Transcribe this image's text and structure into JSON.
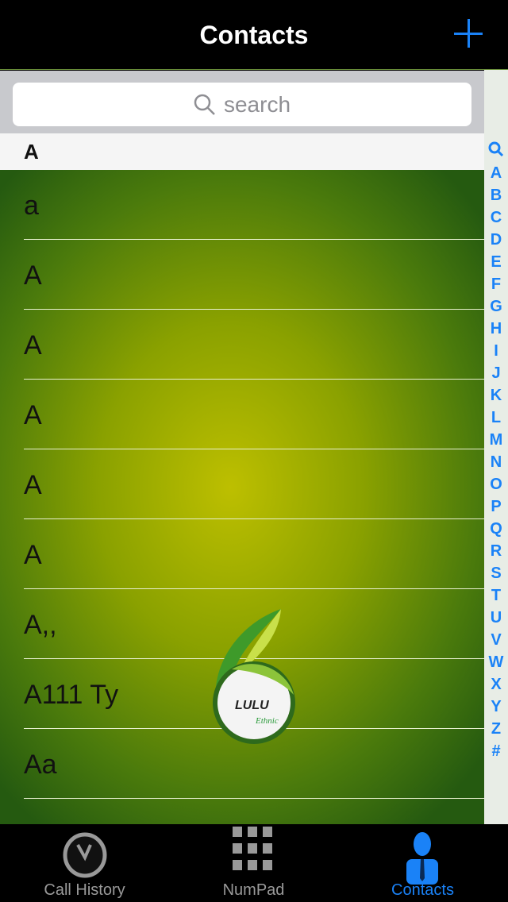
{
  "nav": {
    "title": "Contacts",
    "add_icon": "plus-icon"
  },
  "search": {
    "placeholder": "search"
  },
  "section_header": "A",
  "contacts": [
    "a",
    "A",
    "A",
    "A",
    "A",
    "A",
    "A,,",
    "A111 Ty",
    "Aa"
  ],
  "index": [
    "A",
    "B",
    "C",
    "D",
    "E",
    "F",
    "G",
    "H",
    "I",
    "J",
    "K",
    "L",
    "M",
    "N",
    "O",
    "P",
    "Q",
    "R",
    "S",
    "T",
    "U",
    "V",
    "W",
    "X",
    "Y",
    "Z",
    "#"
  ],
  "logo": {
    "text": "LULU",
    "subtext": "Ethnic"
  },
  "tabs": [
    {
      "label": "Call History",
      "icon": "clock-icon"
    },
    {
      "label": "NumPad",
      "icon": "keypad-icon"
    },
    {
      "label": "Contacts",
      "icon": "person-icon",
      "active": true
    }
  ],
  "colors": {
    "accent": "#1a82f7"
  }
}
